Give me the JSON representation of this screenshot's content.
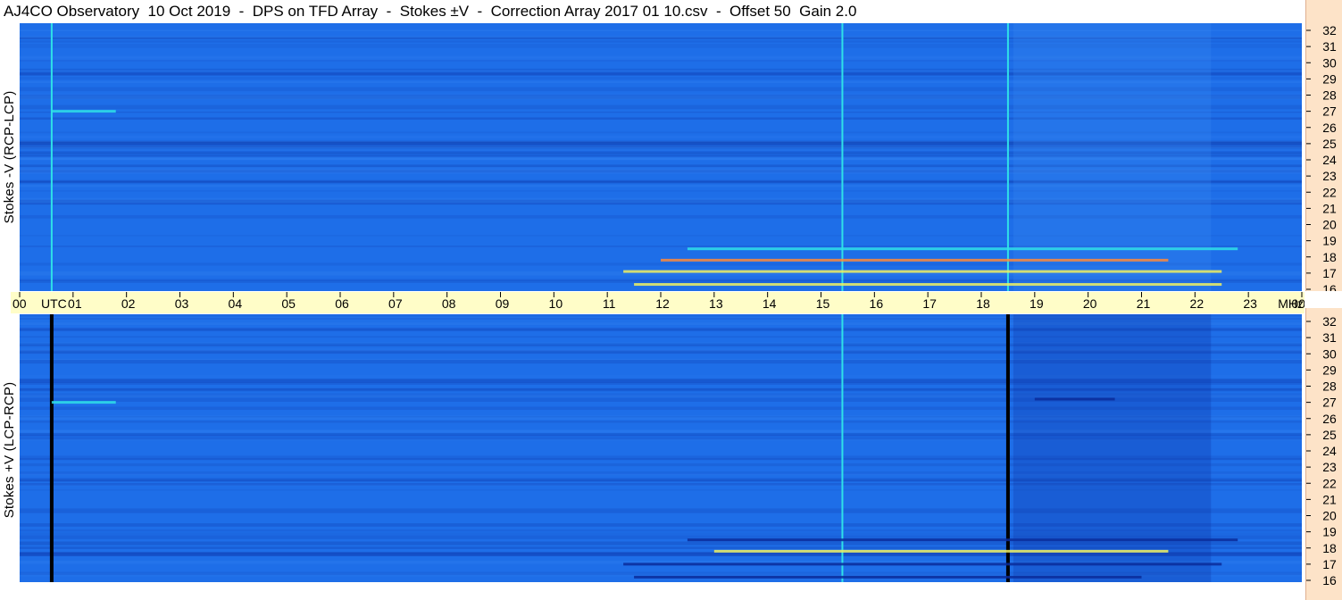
{
  "title": "AJ4CO Observatory  10 Oct 2019  -  DPS on TFD Array  -  Stokes ±V  -  Correction Array 2017 01 10.csv  -  Offset 50  Gain 2.0",
  "panels": {
    "top_label": "Stokes -V (RCP-LCP)",
    "bottom_label": "Stokes +V (LCP-RCP)"
  },
  "colors": {
    "background_blue": "#1e6ee8",
    "dark_blue": "#0b2c9a",
    "cyan": "#2fe0e8",
    "yellow": "#f0f060",
    "orange": "#ff8a3a",
    "utc_axis_bg": "#fffdc8",
    "freq_axis_bg": "#fde3c8"
  },
  "chart_data": {
    "type": "heatmap",
    "x_axis": {
      "unit_label": "UTC",
      "tick_labels": [
        "00",
        "01",
        "02",
        "03",
        "04",
        "05",
        "06",
        "07",
        "08",
        "09",
        "10",
        "11",
        "12",
        "13",
        "14",
        "15",
        "16",
        "17",
        "18",
        "19",
        "20",
        "21",
        "22",
        "23",
        "00"
      ],
      "range": [
        0,
        24
      ]
    },
    "y_axis": {
      "unit_label": "MHz",
      "tick_labels": [
        "16",
        "17",
        "18",
        "19",
        "20",
        "21",
        "22",
        "23",
        "24",
        "25",
        "26",
        "27",
        "28",
        "29",
        "30",
        "31",
        "32"
      ],
      "range": [
        16,
        32
      ]
    },
    "series": [
      {
        "name": "Stokes -V (RCP-LCP)",
        "features": [
          {
            "kind": "vertical_line",
            "utc": 0.6,
            "color": "cyan"
          },
          {
            "kind": "vertical_line",
            "utc": 15.4,
            "color": "cyan"
          },
          {
            "kind": "vertical_line",
            "utc": 18.5,
            "color": "cyan"
          },
          {
            "kind": "horizontal_band",
            "utc_start": 11.5,
            "utc_end": 22.5,
            "mhz": 16.3,
            "color": "yellow"
          },
          {
            "kind": "horizontal_band",
            "utc_start": 11.3,
            "utc_end": 22.5,
            "mhz": 17.1,
            "color": "yellow"
          },
          {
            "kind": "horizontal_band",
            "utc_start": 12.0,
            "utc_end": 21.5,
            "mhz": 17.8,
            "color": "orange"
          },
          {
            "kind": "horizontal_band",
            "utc_start": 12.5,
            "utc_end": 22.8,
            "mhz": 18.5,
            "color": "cyan"
          },
          {
            "kind": "horizontal_band",
            "utc_start": 0.6,
            "utc_end": 1.8,
            "mhz": 27.0,
            "color": "cyan"
          }
        ]
      },
      {
        "name": "Stokes +V (LCP-RCP)",
        "features": [
          {
            "kind": "vertical_line",
            "utc": 0.6,
            "color": "black"
          },
          {
            "kind": "vertical_line",
            "utc": 15.4,
            "color": "cyan"
          },
          {
            "kind": "vertical_line",
            "utc": 18.5,
            "color": "black"
          },
          {
            "kind": "horizontal_band",
            "utc_start": 11.5,
            "utc_end": 21.0,
            "mhz": 16.2,
            "color": "dark_blue"
          },
          {
            "kind": "horizontal_band",
            "utc_start": 11.3,
            "utc_end": 22.5,
            "mhz": 17.0,
            "color": "dark_blue"
          },
          {
            "kind": "horizontal_band",
            "utc_start": 13.0,
            "utc_end": 21.5,
            "mhz": 17.8,
            "color": "yellow"
          },
          {
            "kind": "horizontal_band",
            "utc_start": 12.5,
            "utc_end": 22.8,
            "mhz": 18.5,
            "color": "dark_blue"
          },
          {
            "kind": "horizontal_band",
            "utc_start": 0.6,
            "utc_end": 1.8,
            "mhz": 27.0,
            "color": "cyan"
          },
          {
            "kind": "horizontal_band",
            "utc_start": 19.0,
            "utc_end": 20.5,
            "mhz": 27.2,
            "color": "dark_blue"
          }
        ]
      }
    ]
  }
}
